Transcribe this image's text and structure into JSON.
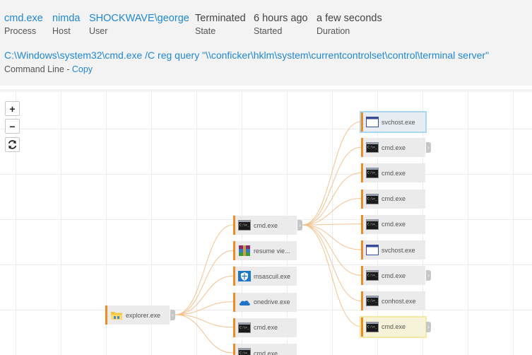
{
  "process": {
    "value": "cmd.exe",
    "label": "Process"
  },
  "host": {
    "value": "nimda",
    "label": "Host"
  },
  "user": {
    "value": "SHOCKWAVE\\george",
    "label": "User"
  },
  "state": {
    "value": "Terminated",
    "label": "State"
  },
  "started": {
    "value": "6 hours ago",
    "label": "Started"
  },
  "duration": {
    "value": "a few seconds",
    "label": "Duration"
  },
  "command_line": {
    "value": "C:\\Windows\\system32\\cmd.exe /C reg query \"\\\\conficker\\hklm\\system\\currentcontrolset\\control\\terminal server\"",
    "label": "Command Line - ",
    "copy_label": "Copy"
  },
  "zoom": {
    "in": "+",
    "out": "−",
    "reset_icon": "refresh-icon"
  },
  "accent": "#f08a24",
  "link_color": "#1f87d6",
  "graph": {
    "root": {
      "name": "explorer.exe",
      "icon": "explorer-folder-icon"
    },
    "level1": [
      {
        "name": "cmd.exe",
        "icon": "console-icon",
        "expanded": true
      },
      {
        "name": "resume vie...",
        "icon": "archive-icon"
      },
      {
        "name": "msascuil.exe",
        "icon": "defender-shield-icon"
      },
      {
        "name": "onedrive.exe",
        "icon": "onedrive-cloud-icon"
      },
      {
        "name": "cmd.exe",
        "icon": "console-icon"
      },
      {
        "name": "cmd.exe",
        "icon": "console-icon"
      }
    ],
    "level2": [
      {
        "name": "svchost.exe",
        "icon": "window-icon",
        "highlight": "blue"
      },
      {
        "name": "cmd.exe",
        "icon": "console-icon",
        "has_children": true
      },
      {
        "name": "cmd.exe",
        "icon": "console-icon"
      },
      {
        "name": "cmd.exe",
        "icon": "console-icon"
      },
      {
        "name": "cmd.exe",
        "icon": "console-icon"
      },
      {
        "name": "svchost.exe",
        "icon": "window-icon"
      },
      {
        "name": "cmd.exe",
        "icon": "console-icon",
        "has_children": true
      },
      {
        "name": "conhost.exe",
        "icon": "console-icon"
      },
      {
        "name": "cmd.exe",
        "icon": "console-icon",
        "has_children": true,
        "highlight": "yellow"
      }
    ]
  }
}
